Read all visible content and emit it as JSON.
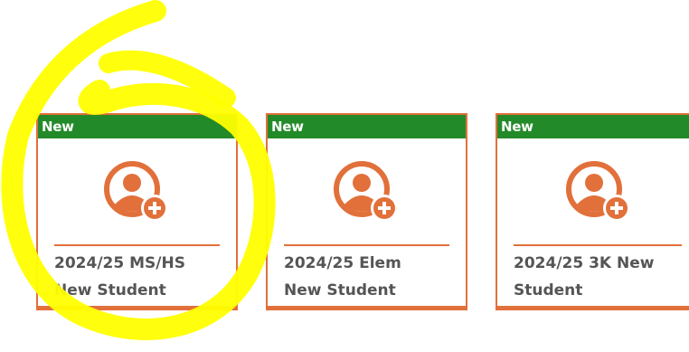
{
  "tiles": [
    {
      "badge": "New",
      "title": "2024/25 MS/HS\nNew Student",
      "icon": "add-user-icon"
    },
    {
      "badge": "New",
      "title": "2024/25 Elem\nNew Student",
      "icon": "add-user-icon"
    },
    {
      "badge": "New",
      "title": "2024/25 3K New\nStudent",
      "icon": "add-user-icon"
    }
  ],
  "colors": {
    "accent": "#e2703a",
    "badge": "#238a2a",
    "highlight": "#ffff00"
  }
}
